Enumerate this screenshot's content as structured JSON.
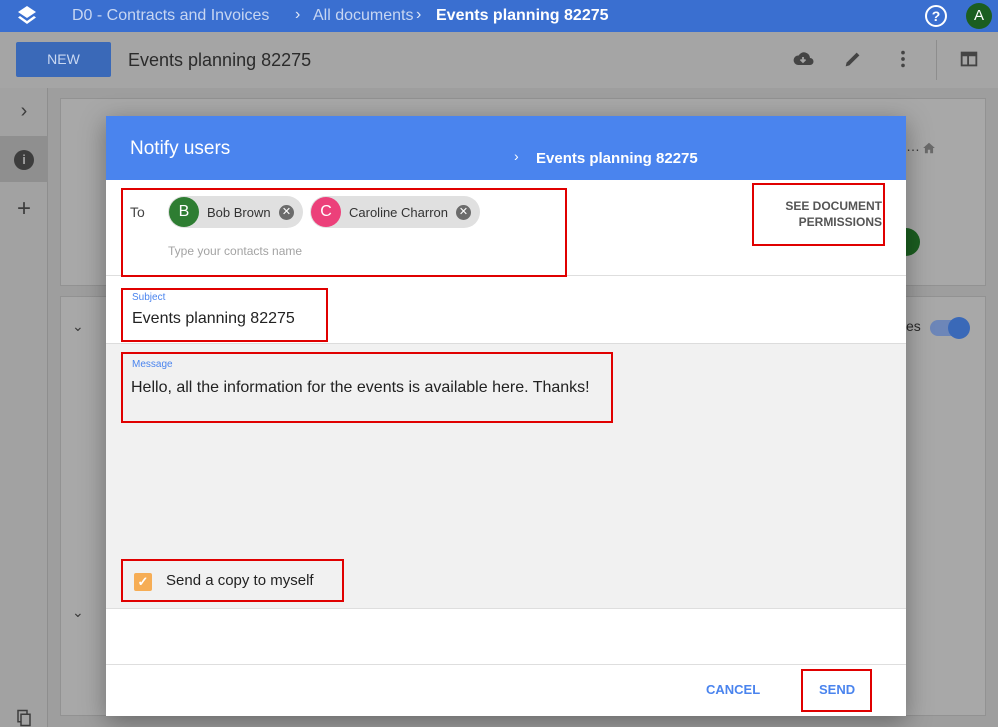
{
  "topbar": {
    "app_title": "D0 - Contracts and Invoices",
    "crumb_all": "All documents",
    "crumb_current": "Events planning 82275",
    "help_icon": "?",
    "user_initial": "A"
  },
  "toolbar": {
    "new_label": "NEW",
    "doc_title": "Events planning 82275",
    "icons": [
      "cloud-download-icon",
      "pencil-icon",
      "more-vert-icon",
      "layout-icon"
    ]
  },
  "rail": {
    "expand_icon": "›",
    "info_icon": "i",
    "add_icon": "+"
  },
  "background": {
    "toggle_label": "es"
  },
  "dialog": {
    "title": "Notify users",
    "doc_name": "Events planning 82275",
    "to_label": "To",
    "recipients": [
      {
        "initial": "B",
        "name": "Bob Brown",
        "color": "#2e7d32"
      },
      {
        "initial": "C",
        "name": "Caroline Charron",
        "color": "#ec407a"
      }
    ],
    "contacts_placeholder": "Type your contacts name",
    "permissions_line1": "SEE DOCUMENT",
    "permissions_line2": "PERMISSIONS",
    "subject_label": "Subject",
    "subject_value": "Events planning 82275",
    "message_label": "Message",
    "message_value": "Hello, all the information for the events is available here. Thanks!",
    "copy_label": "Send a copy to myself",
    "copy_checked": true,
    "cancel_label": "CANCEL",
    "send_label": "SEND"
  },
  "colors": {
    "header_blue": "#4a84ee",
    "topbar_blue": "#3a6fd0",
    "highlight_red": "#e00000",
    "checkbox_orange": "#f6ad55"
  }
}
